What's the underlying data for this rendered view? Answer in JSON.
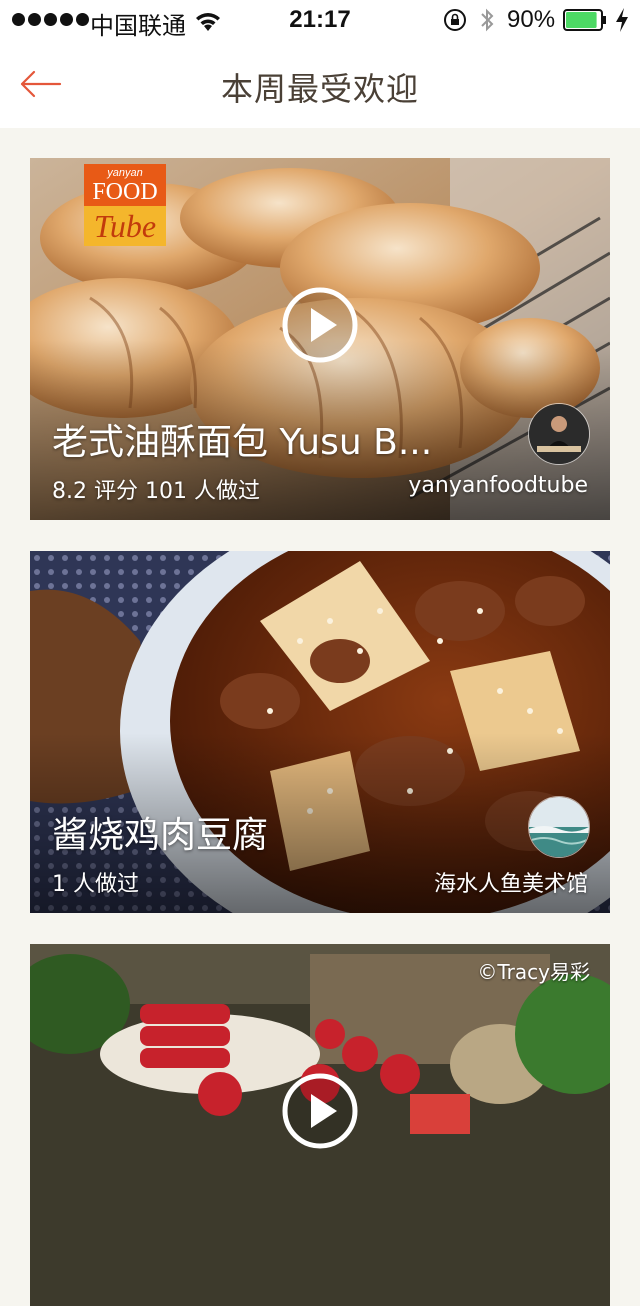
{
  "status_bar": {
    "carrier": "中国联通",
    "time": "21:17",
    "battery_percent": "90%",
    "battery_level": 0.9,
    "battery_color": "#4cd964",
    "icons": [
      "signal-dots-icon",
      "wifi-icon",
      "orientation-lock-icon",
      "bluetooth-icon",
      "battery-icon",
      "charging-icon"
    ]
  },
  "nav": {
    "title": "本周最受欢迎",
    "back_icon": "arrow-left-icon",
    "accent_color": "#e4573a"
  },
  "cards": [
    {
      "title": "老式油酥面包 Yusu B...",
      "meta": "8.2 评分 101 人做过",
      "author": "yanyanfoodtube",
      "has_play": true,
      "logo": {
        "line1": "yanyan",
        "line2": "FOOD",
        "line3": "Tube"
      }
    },
    {
      "title": "酱烧鸡肉豆腐",
      "meta": "1 人做过",
      "author": "海水人鱼美术馆",
      "has_play": false
    },
    {
      "title": "",
      "meta": "",
      "author": "",
      "has_play": true,
      "watermark": "©Tracy易彩"
    }
  ]
}
